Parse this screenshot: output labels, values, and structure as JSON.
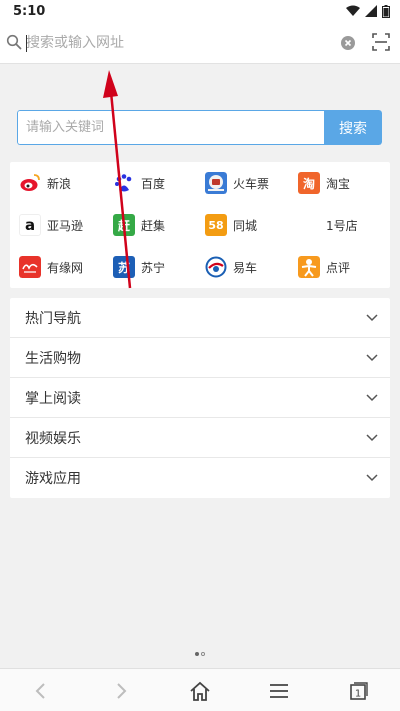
{
  "status_bar": {
    "time": "5:10"
  },
  "address_bar": {
    "placeholder": "搜索或输入网址"
  },
  "search": {
    "placeholder": "请输入关键词",
    "button_label": "搜索"
  },
  "sites": [
    {
      "label": "新浪",
      "icon": "sina-weibo-icon"
    },
    {
      "label": "百度",
      "icon": "baidu-icon"
    },
    {
      "label": "火车票",
      "icon": "train-ticket-icon"
    },
    {
      "label": "淘宝",
      "icon": "taobao-icon",
      "logo_text": "淘"
    },
    {
      "label": "亚马逊",
      "icon": "amazon-icon",
      "logo_text": "a"
    },
    {
      "label": "赶集",
      "icon": "ganji-icon",
      "logo_text": "赶"
    },
    {
      "label": "同城",
      "icon": "58-tongcheng-icon",
      "logo_text": "58"
    },
    {
      "label": "1号店",
      "icon": "yhd-icon"
    },
    {
      "label": "有缘网",
      "icon": "youyuan-icon"
    },
    {
      "label": "苏宁",
      "icon": "suning-icon",
      "logo_text": "苏"
    },
    {
      "label": "易车",
      "icon": "yiche-icon"
    },
    {
      "label": "点评",
      "icon": "dianping-icon"
    }
  ],
  "categories": [
    {
      "label": "热门导航"
    },
    {
      "label": "生活购物"
    },
    {
      "label": "掌上阅读"
    },
    {
      "label": "视频娱乐"
    },
    {
      "label": "游戏应用"
    }
  ],
  "colors": {
    "accent": "#5aa7e6",
    "annotation": "#d0021b"
  }
}
